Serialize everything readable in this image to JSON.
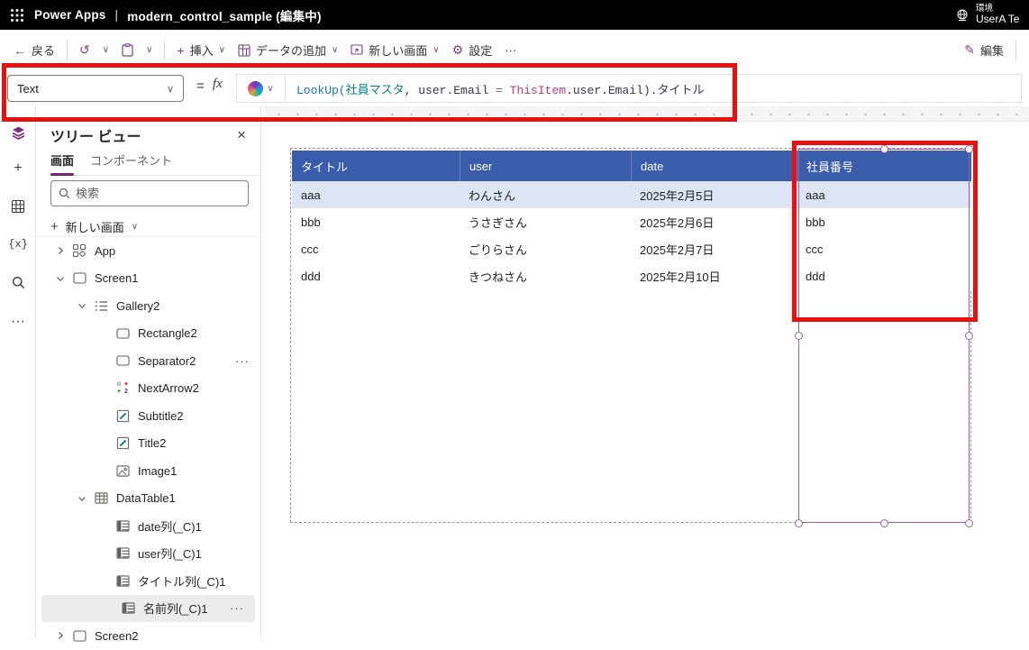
{
  "topbar": {
    "app_name": "Power Apps",
    "separator": "|",
    "file_title": "modern_control_sample (編集中)",
    "environment_label": "環境",
    "environment_value": "UserA Te"
  },
  "toolbar": {
    "back_label": "戻る",
    "insert_label": "挿入",
    "add_data_label": "データの追加",
    "new_screen_label": "新しい画面",
    "settings_label": "設定",
    "more_label": "···",
    "edit_label": "編集"
  },
  "formula_bar": {
    "property_selector_value": "Text",
    "equals_sign": "=",
    "fx_label": "fx",
    "formula_tokens": [
      {
        "text": "LookUp(",
        "color": "#1373c4"
      },
      {
        "text": "社員マスタ",
        "color": "#038387"
      },
      {
        "text": ", ",
        "color": "#3b3a39"
      },
      {
        "text": "user.Email",
        "color": "#323657"
      },
      {
        "text": " = ",
        "color": "#5f6a6a"
      },
      {
        "text": "ThisItem",
        "color": "#c0397c"
      },
      {
        "text": ".user.Email)",
        "color": "#323657"
      },
      {
        "text": ".タイトル",
        "color": "#323657"
      }
    ]
  },
  "left_rail": {
    "items": [
      {
        "name": "tree-view",
        "selected": true
      },
      {
        "name": "insert"
      },
      {
        "name": "data"
      },
      {
        "name": "variables",
        "label": "{x}"
      },
      {
        "name": "search"
      },
      {
        "name": "more",
        "label": "···"
      }
    ]
  },
  "tree_panel": {
    "title": "ツリー ビュー",
    "close_label": "×",
    "tabs": [
      {
        "label": "画面",
        "active": true
      },
      {
        "label": "コンポーネント",
        "active": false
      }
    ],
    "search_placeholder": "検索",
    "new_screen_label": "新しい画面",
    "items": [
      {
        "label": "App",
        "level": 0,
        "chevron": "right",
        "icon": "app"
      },
      {
        "label": "Screen1",
        "level": 0,
        "chevron": "down",
        "icon": "screen"
      },
      {
        "label": "Gallery2",
        "level": 1,
        "chevron": "down",
        "icon": "gallery"
      },
      {
        "label": "Rectangle2",
        "level": 2,
        "chevron": null,
        "icon": "rect"
      },
      {
        "label": "Separator2",
        "level": 2,
        "chevron": null,
        "icon": "rect",
        "more": true
      },
      {
        "label": "NextArrow2",
        "level": 2,
        "chevron": null,
        "icon": "nextarrow"
      },
      {
        "label": "Subtitle2",
        "level": 2,
        "chevron": null,
        "icon": "pencil"
      },
      {
        "label": "Title2",
        "level": 2,
        "chevron": null,
        "icon": "pencil"
      },
      {
        "label": "Image1",
        "level": 2,
        "chevron": null,
        "icon": "image"
      },
      {
        "label": "DataTable1",
        "level": 1,
        "chevron": "down",
        "icon": "table"
      },
      {
        "label": "date列(_C)1",
        "level": 2,
        "chevron": null,
        "icon": "column"
      },
      {
        "label": "user列(_C)1",
        "level": 2,
        "chevron": null,
        "icon": "column"
      },
      {
        "label": "タイトル列(_C)1",
        "level": 2,
        "chevron": null,
        "icon": "column"
      },
      {
        "label": "名前列(_C)1",
        "level": 2,
        "chevron": null,
        "icon": "column",
        "selected": true,
        "more": true
      },
      {
        "label": "Screen2",
        "level": 0,
        "chevron": "right",
        "icon": "screen"
      }
    ]
  },
  "canvas": {
    "table": {
      "headers": [
        "タイトル",
        "user",
        "date",
        "社員番号"
      ],
      "rows": [
        [
          "aaa",
          "わんさん",
          "2025年2月5日",
          "aaa"
        ],
        [
          "bbb",
          "うさぎさん",
          "2025年2月6日",
          "bbb"
        ],
        [
          "ccc",
          "ごりらさん",
          "2025年2月7日",
          "ccc"
        ],
        [
          "ddd",
          "きつねさん",
          "2025年2月10日",
          "ddd"
        ]
      ],
      "selected_row_index": 0,
      "header_bg": "#3a5dab",
      "selected_row_bg": "#dde4f4"
    }
  },
  "annotations": {
    "highlight_color": "#e81111"
  }
}
